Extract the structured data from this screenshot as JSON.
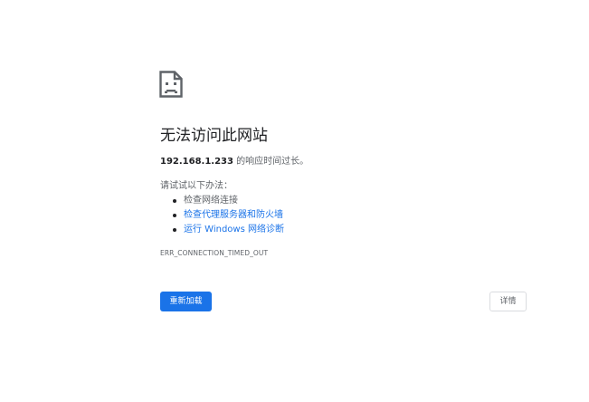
{
  "error": {
    "icon": "sad-page-icon",
    "title": "无法访问此网站",
    "host": "192.168.1.233",
    "timeout_text": " 的响应时间过长。",
    "try_label": "请试试以下办法：",
    "suggestions": [
      {
        "label": "检查网络连接",
        "is_link": false
      },
      {
        "label": "检查代理服务器和防火墙",
        "is_link": true
      },
      {
        "label": "运行 Windows 网络诊断",
        "is_link": true
      }
    ],
    "code": "ERR_CONNECTION_TIMED_OUT"
  },
  "buttons": {
    "reload_label": "重新加载",
    "details_label": "详情"
  },
  "colors": {
    "accent": "#1a73e8",
    "text_primary": "#202124",
    "text_secondary": "#5f6368",
    "border": "#dadce0"
  }
}
